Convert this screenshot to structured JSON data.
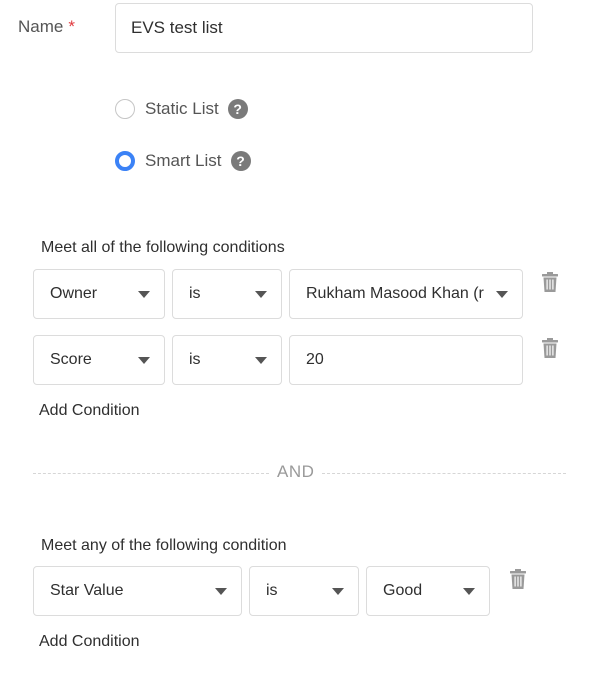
{
  "form": {
    "name_label": "Name",
    "required_marker": "*",
    "name_value": "EVS test list"
  },
  "list_type": {
    "options": [
      {
        "label": "Static List",
        "selected": false
      },
      {
        "label": "Smart List",
        "selected": true
      }
    ],
    "help_glyph": "?"
  },
  "all_group": {
    "title": "Meet all of the following conditions",
    "conditions": [
      {
        "field": "Owner",
        "operator": "is",
        "value": "Rukham Masood Khan (r",
        "value_type": "select"
      },
      {
        "field": "Score",
        "operator": "is",
        "value": "20",
        "value_type": "text"
      }
    ],
    "add_label": "Add Condition"
  },
  "separator": {
    "label": "AND"
  },
  "any_group": {
    "title": "Meet any of the following condition",
    "conditions": [
      {
        "field": "Star Value",
        "operator": "is",
        "value": "Good",
        "value_type": "select"
      }
    ],
    "add_label": "Add Condition"
  },
  "icons": {
    "help": "question-circle-icon",
    "delete": "trash-icon",
    "dropdown": "caret-down-icon"
  },
  "colors": {
    "accent": "#3b82f6",
    "required": "#e0393e",
    "border": "#dcdcdc"
  }
}
